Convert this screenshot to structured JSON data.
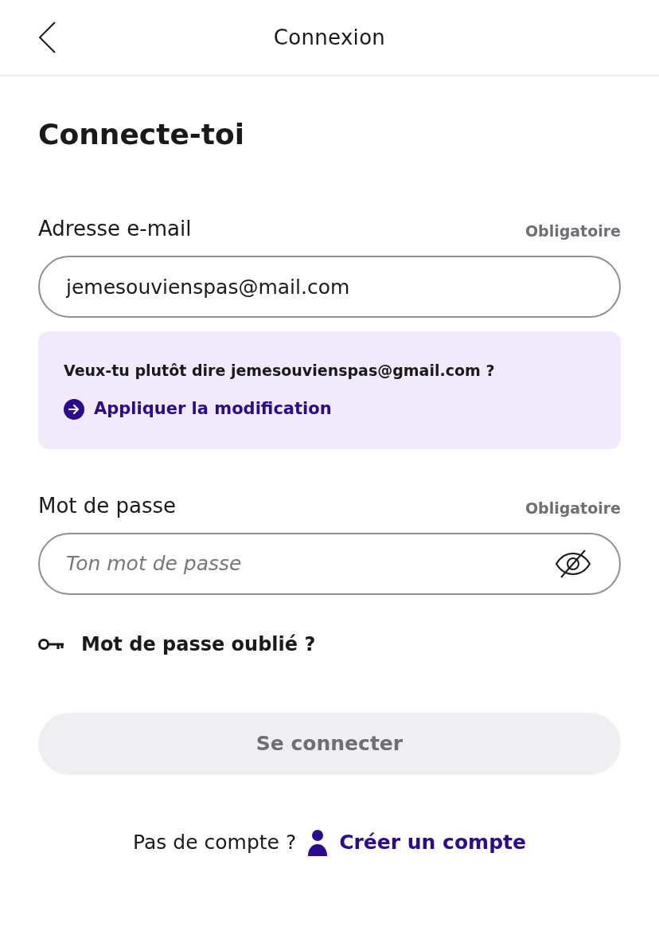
{
  "header": {
    "title": "Connexion"
  },
  "heading": "Connecte-toi",
  "email_field": {
    "label": "Adresse e-mail",
    "requirement": "Obligatoire",
    "value": "jemesouvienspas@mail.com"
  },
  "suggestion": {
    "text": "Veux-tu plutôt dire jemesouvienspas@gmail.com ?",
    "action": "Appliquer la modification"
  },
  "password_field": {
    "label": "Mot de passe",
    "requirement": "Obligatoire",
    "placeholder": "Ton mot de passe"
  },
  "forgot_password_link": "Mot de passe oublié ?",
  "submit_button": {
    "label": "Se connecter",
    "disabled": true
  },
  "footer": {
    "text": "Pas de compte ?",
    "link": "Créer un compte"
  }
}
